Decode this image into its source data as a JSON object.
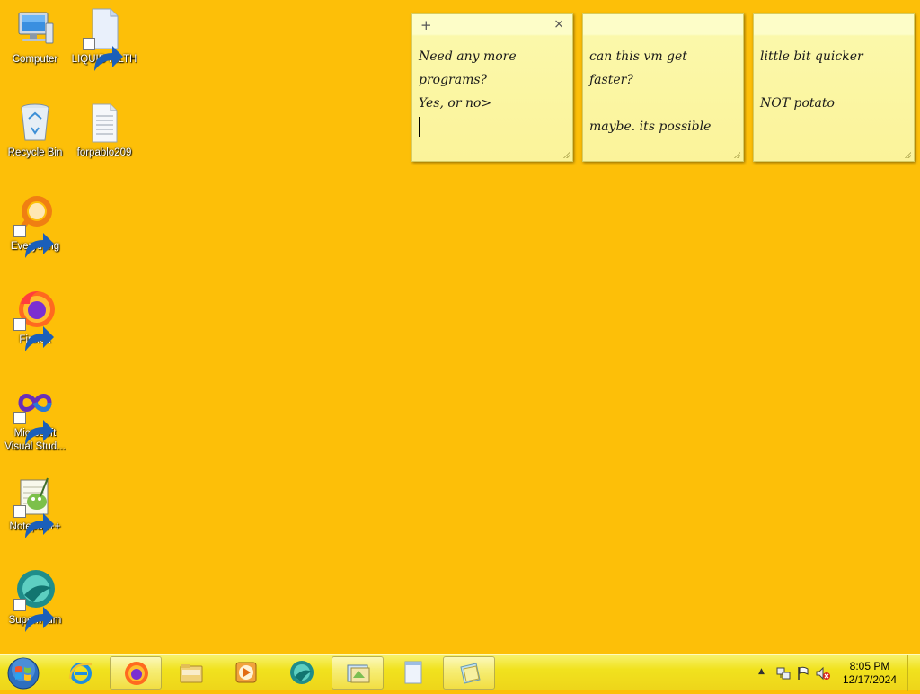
{
  "desktop": {
    "background_color": "#FDBF08",
    "icons": [
      {
        "label": "Computer",
        "icon": "computer-icon",
        "shortcut": false
      },
      {
        "label": "LIQUID FILTH",
        "icon": "document-icon",
        "shortcut": true
      },
      {
        "label": "Recycle Bin",
        "icon": "recycle-bin-icon",
        "shortcut": false
      },
      {
        "label": "forpablo209",
        "icon": "text-file-icon",
        "shortcut": false
      },
      {
        "label": "Everything",
        "icon": "everything-icon",
        "shortcut": true
      },
      {
        "label": "Firefox",
        "icon": "firefox-icon",
        "shortcut": true
      },
      {
        "label": "Microsoft Visual Stud...",
        "icon": "visual-studio-icon",
        "shortcut": true
      },
      {
        "label": "Notepad++",
        "icon": "notepad-plus-plus-icon",
        "shortcut": true
      },
      {
        "label": "Supermium",
        "icon": "supermium-icon",
        "shortcut": true
      }
    ]
  },
  "sticky_notes": [
    {
      "add_symbol": "+",
      "close_symbol": "×",
      "text": "Need any more\nprograms?\nYes, or no>"
    },
    {
      "text": "can this vm get\nfaster?\n\nmaybe. its possible"
    },
    {
      "text": "little bit quicker\n\nNOT potato"
    }
  ],
  "taskbar": {
    "pinned": [
      {
        "name": "internet-explorer",
        "icon": "internet-explorer-icon",
        "active": false
      },
      {
        "name": "firefox",
        "icon": "firefox-icon",
        "active": true
      },
      {
        "name": "file-explorer",
        "icon": "folder-icon",
        "active": false
      },
      {
        "name": "media-player",
        "icon": "media-player-icon",
        "active": false
      },
      {
        "name": "supermium",
        "icon": "supermium-icon",
        "active": false
      },
      {
        "name": "windows-explorer",
        "icon": "explorer-window-icon",
        "active": true
      },
      {
        "name": "notepad",
        "icon": "notepad-icon",
        "active": false
      },
      {
        "name": "sticky-notes",
        "icon": "sticky-notes-icon",
        "active": true
      }
    ],
    "tray": {
      "show_hidden_symbol": "▲",
      "time": "8:05 PM",
      "date": "12/17/2024"
    }
  }
}
